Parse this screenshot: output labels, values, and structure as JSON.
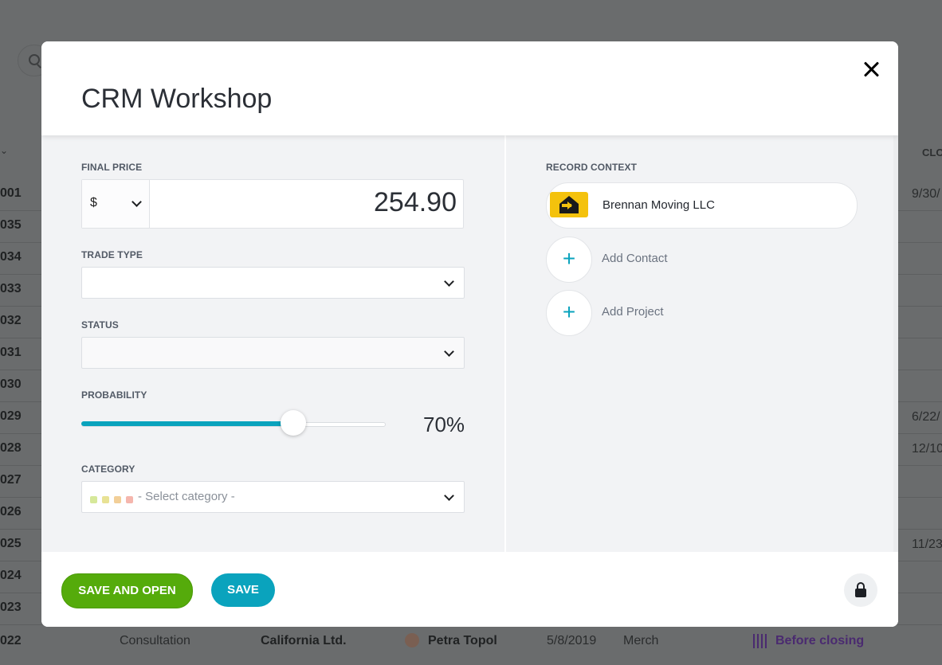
{
  "background": {
    "column_header": "CLO",
    "rows": [
      {
        "id": "001",
        "date": "9/30/"
      },
      {
        "id": "035",
        "date": ""
      },
      {
        "id": "034",
        "date": ""
      },
      {
        "id": "033",
        "date": ""
      },
      {
        "id": "032",
        "date": ""
      },
      {
        "id": "031",
        "date": ""
      },
      {
        "id": "030",
        "date": ""
      },
      {
        "id": "029",
        "date": "6/22/"
      },
      {
        "id": "028",
        "date": "12/10"
      },
      {
        "id": "027",
        "date": ""
      },
      {
        "id": "026",
        "date": ""
      },
      {
        "id": "025",
        "date": "11/23"
      },
      {
        "id": "024",
        "date": ""
      },
      {
        "id": "023",
        "date": ""
      }
    ],
    "last_row": {
      "id": "022",
      "type": "Consultation",
      "company": "California Ltd.",
      "person": "Petra Topol",
      "date": "5/8/2019",
      "category": "Merch",
      "stage": "Before closing",
      "stage_color": "#4a2a70"
    }
  },
  "modal": {
    "title": "CRM Workshop",
    "final_price": {
      "label": "FINAL PRICE",
      "currency": "$",
      "value": "254.90"
    },
    "trade_type": {
      "label": "TRADE TYPE",
      "value": ""
    },
    "status": {
      "label": "STATUS",
      "value": ""
    },
    "probability": {
      "label": "PROBABILITY",
      "value_text": "70%",
      "value": 70
    },
    "category": {
      "label": "CATEGORY",
      "placeholder": "- Select category -",
      "dot_colors": [
        "#d6e89a",
        "#e8e294",
        "#f2cf98",
        "#f5b6ad"
      ]
    },
    "record_context": {
      "label": "RECORD CONTEXT",
      "company": "Brennan Moving LLC",
      "add_contact": "Add Contact",
      "add_project": "Add Project"
    },
    "footer": {
      "save_and_open": "SAVE AND OPEN",
      "save": "SAVE"
    },
    "colors": {
      "accent_teal": "#0aa3bd",
      "accent_green": "#55ab0b",
      "logo_yellow": "#f4c20d"
    }
  }
}
